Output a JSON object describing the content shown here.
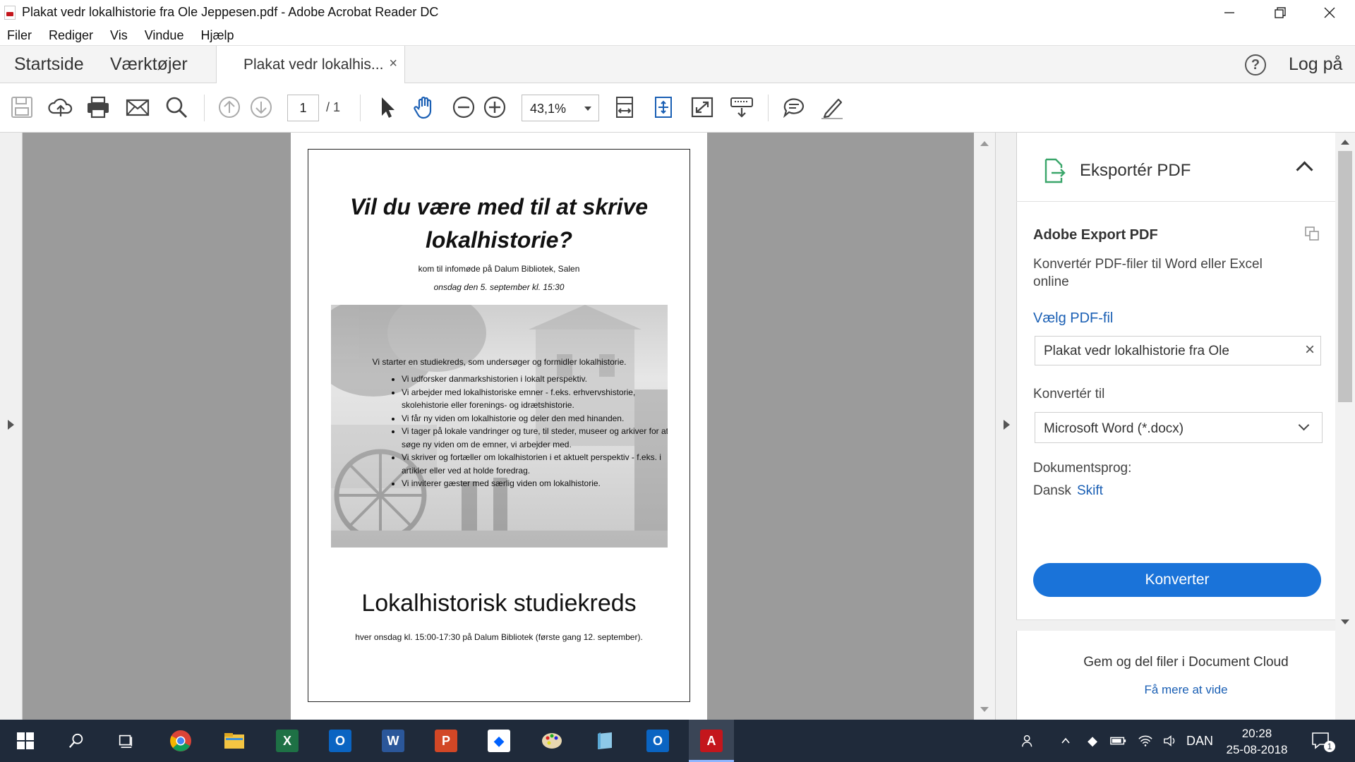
{
  "window": {
    "title": "Plakat vedr lokalhistorie fra Ole Jeppesen.pdf - Adobe Acrobat Reader DC"
  },
  "menu": [
    "Filer",
    "Rediger",
    "Vis",
    "Vindue",
    "Hjælp"
  ],
  "tabs": {
    "home": "Startside",
    "tools": "Værktøjer",
    "document": "Plakat vedr lokalhis...",
    "close": "×",
    "help": "?",
    "login": "Log på"
  },
  "toolbar": {
    "page_current": "1",
    "page_total": "/ 1",
    "zoom": "43,1%"
  },
  "poster": {
    "title": "Vil du være med til at skrive lokalhistorie?",
    "line1": "kom til infomøde på Dalum Bibliotek, Salen",
    "line2": "onsdag den 5. september kl. 15:30",
    "intro": "Vi starter en studiekreds, som undersøger og formidler lokalhistorie.",
    "bullets": [
      "Vi udforsker danmarkshistorien i lokalt perspektiv.",
      "Vi arbejder med lokalhistoriske emner - f.eks. erhvervshistorie, skolehistorie eller forenings- og idrætshistorie.",
      "Vi får ny viden om lokalhistorie og deler den med hinanden.",
      "Vi tager på lokale vandringer og ture, til steder, museer og arkiver for at søge ny viden om de emner, vi arbejder med.",
      "Vi skriver og fortæller om lokalhistorien i et aktuelt perspektiv - f.eks. i artikler eller ved at holde foredrag.",
      "Vi inviterer gæster med særlig viden om lokalhistorie."
    ],
    "subtitle": "Lokalhistorisk studiekreds",
    "footer": "hver onsdag kl. 15:00-17:30 på Dalum Bibliotek (første gang 12. september)."
  },
  "panel": {
    "title": "Eksportér PDF",
    "section_title": "Adobe Export PDF",
    "description": "Konvertér PDF-filer til Word eller Excel online",
    "choose_file": "Vælg PDF-fil",
    "file_value": "Plakat vedr lokalhistorie fra Ole",
    "clear": "×",
    "convert_to_label": "Konvertér til",
    "convert_to_value": "Microsoft Word (*.docx)",
    "lang_label": "Dokumentsprog:",
    "lang_value": "Dansk",
    "lang_change": "Skift",
    "convert_button": "Konverter",
    "cloud_title": "Gem og del filer i Document Cloud",
    "cloud_link": "Få mere at vide"
  },
  "taskbar": {
    "lang": "DAN",
    "time": "20:28",
    "date": "25-08-2018",
    "notifications": "1"
  },
  "colors": {
    "accent": "#1a73d9",
    "link": "#1a5fb4",
    "acrobat_red": "#c4161c",
    "taskbar": "#1f2a3a"
  }
}
